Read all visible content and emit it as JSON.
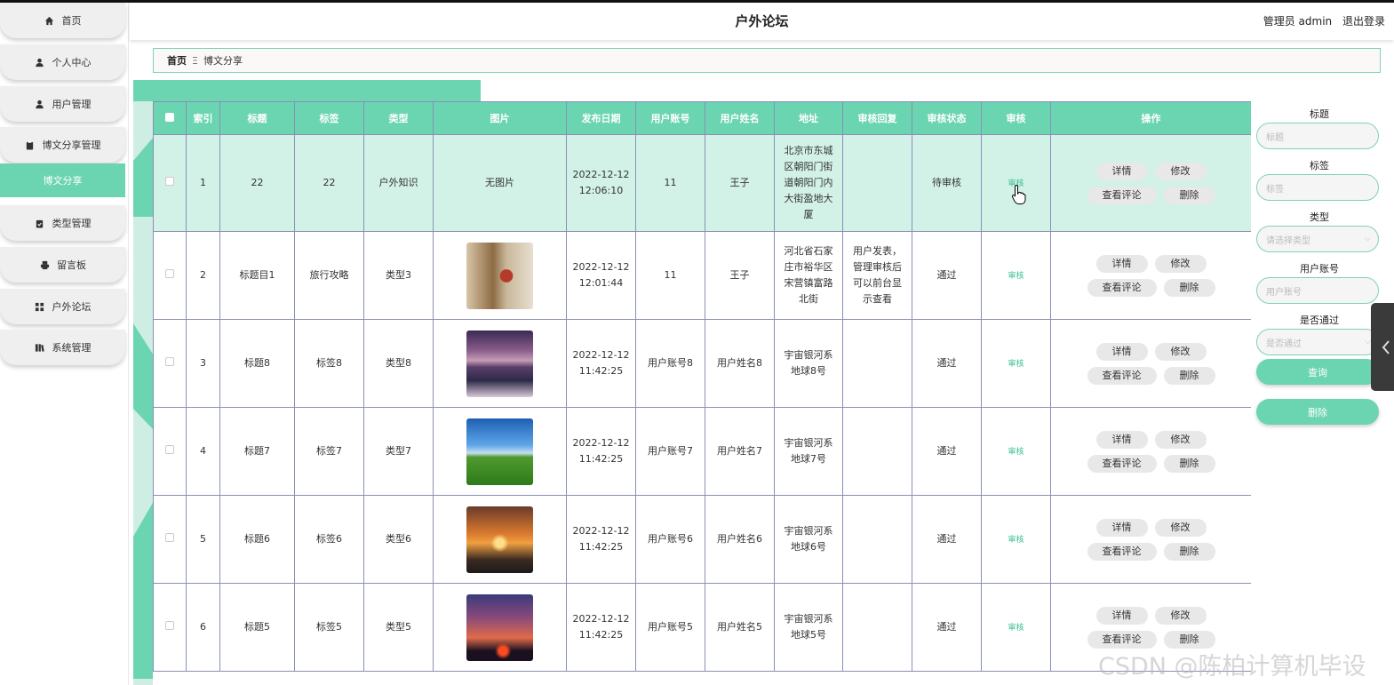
{
  "app": {
    "title": "户外论坛",
    "user_label": "管理员 admin",
    "logout": "退出登录"
  },
  "sidebar": {
    "items": [
      {
        "label": "首页",
        "icon": "home-icon"
      },
      {
        "label": "个人中心",
        "icon": "user-icon"
      },
      {
        "label": "用户管理",
        "icon": "user-icon"
      },
      {
        "label": "博文分享管理",
        "icon": "clipboard-icon"
      },
      {
        "label": "博文分享",
        "icon": ""
      },
      {
        "label": "类型管理",
        "icon": "clipboard-icon"
      },
      {
        "label": "留言板",
        "icon": "print-icon"
      },
      {
        "label": "户外论坛",
        "icon": "grid-icon"
      },
      {
        "label": "系统管理",
        "icon": "book-icon"
      }
    ]
  },
  "breadcrumb": {
    "home": "首页",
    "separator": "Ξ",
    "current": "博文分享"
  },
  "table": {
    "columns": [
      "",
      "索引",
      "标题",
      "标签",
      "类型",
      "图片",
      "发布日期",
      "用户账号",
      "用户姓名",
      "地址",
      "审核回复",
      "审核状态",
      "审核",
      "操作"
    ],
    "rows": [
      {
        "index": "1",
        "title": "22",
        "tag": "22",
        "type": "户外知识",
        "image": "无图片",
        "image_kind": "none",
        "date": "2022-12-12",
        "time": "12:06:10",
        "account": "11",
        "name": "王子",
        "address": "北京市东城区朝阳门街道朝阳门内大街盈地大厦",
        "reply": "",
        "status": "待审核",
        "audit": "审核"
      },
      {
        "index": "2",
        "title": "标题目1",
        "tag": "旅行攻略",
        "type": "类型3",
        "image": "",
        "image_kind": "lantern",
        "date": "2022-12-12",
        "time": "12:01:44",
        "account": "11",
        "name": "王子",
        "address": "河北省石家庄市裕华区宋营镇富路北街",
        "reply": "用户发表，管理审核后可以前台显示查看",
        "status": "通过",
        "audit": "审核"
      },
      {
        "index": "3",
        "title": "标题8",
        "tag": "标签8",
        "type": "类型8",
        "image": "",
        "image_kind": "lake",
        "date": "2022-12-12",
        "time": "11:42:25",
        "account": "用户账号8",
        "name": "用户姓名8",
        "address": "宇宙银河系地球8号",
        "reply": "",
        "status": "通过",
        "audit": "审核"
      },
      {
        "index": "4",
        "title": "标题7",
        "tag": "标签7",
        "type": "类型7",
        "image": "",
        "image_kind": "field",
        "date": "2022-12-12",
        "time": "11:42:25",
        "account": "用户账号7",
        "name": "用户姓名7",
        "address": "宇宙银河系地球7号",
        "reply": "",
        "status": "通过",
        "audit": "审核"
      },
      {
        "index": "5",
        "title": "标题6",
        "tag": "标签6",
        "type": "类型6",
        "image": "",
        "image_kind": "sunset",
        "date": "2022-12-12",
        "time": "11:42:25",
        "account": "用户账号6",
        "name": "用户姓名6",
        "address": "宇宙银河系地球6号",
        "reply": "",
        "status": "通过",
        "audit": "审核"
      },
      {
        "index": "6",
        "title": "标题5",
        "tag": "标签5",
        "type": "类型5",
        "image": "",
        "image_kind": "dusk",
        "date": "2022-12-12",
        "time": "11:42:25",
        "account": "用户账号5",
        "name": "用户姓名5",
        "address": "宇宙银河系地球5号",
        "reply": "",
        "status": "通过",
        "audit": "审核"
      }
    ],
    "ops": {
      "detail": "详情",
      "edit": "修改",
      "comments": "查看评论",
      "delete": "删除"
    }
  },
  "search": {
    "title_label": "标题",
    "title_placeholder": "标题",
    "tag_label": "标签",
    "tag_placeholder": "标签",
    "type_label": "类型",
    "type_placeholder": "请选择类型",
    "account_label": "用户账号",
    "account_placeholder": "用户账号",
    "pass_label": "是否通过",
    "pass_placeholder": "是否通过",
    "query_button": "查询",
    "delete_button": "删除"
  },
  "watermark": "CSDN @陈柏计算机毕设",
  "colors": {
    "accent": "#6bd4b0",
    "highlight_row": "#d2f1e7",
    "link": "#3cbf95"
  }
}
